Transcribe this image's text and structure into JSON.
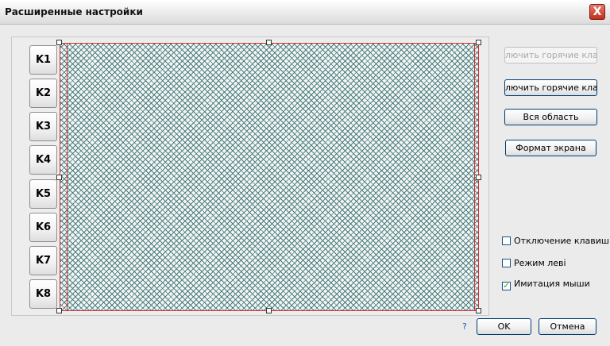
{
  "window": {
    "title": "Расширенные настройки",
    "close_label": "X"
  },
  "keys": [
    "K1",
    "K2",
    "K3",
    "K4",
    "K5",
    "K6",
    "K7",
    "K8"
  ],
  "right_buttons": {
    "enable_hotkeys_disabled": "лючить горячие клави",
    "enable_hotkeys": "лючить горячие клави",
    "full_area": "Вся область",
    "screen_format": "Формат экрана"
  },
  "checkboxes": [
    {
      "label": "Отключение клавиш",
      "checked": false
    },
    {
      "label": "Режим леві",
      "checked": false
    },
    {
      "label": "Имитация мыши",
      "checked": true
    }
  ],
  "help_label": "?",
  "ok_label": "OK",
  "cancel_label": "Отмена"
}
